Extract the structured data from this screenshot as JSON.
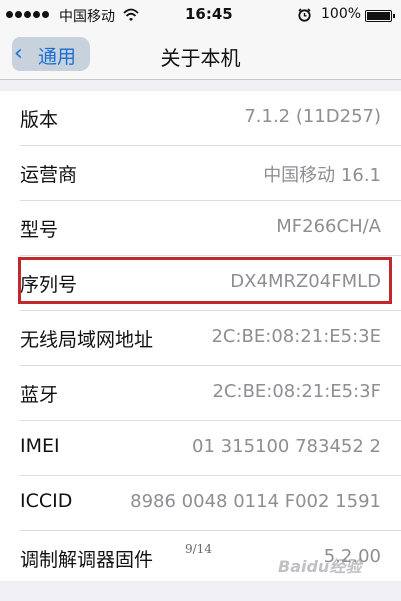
{
  "status_bar": {
    "carrier": "中国移动",
    "time": "16:45",
    "battery": "100%",
    "signal_bars": 5,
    "icons": [
      "signal-dots-icon",
      "wifi-icon",
      "alarm-clock-icon",
      "battery-icon"
    ]
  },
  "nav": {
    "back_label": "通用",
    "title": "关于本机"
  },
  "rows": [
    {
      "label": "版本",
      "value": "7.1.2 (11D257)"
    },
    {
      "label": "运营商",
      "value": "中国移动 16.1"
    },
    {
      "label": "型号",
      "value": "MF266CH/A"
    },
    {
      "label": "序列号",
      "value": "DX4MRZ04FMLD"
    },
    {
      "label": "无线局域网地址",
      "value": "2C:BE:08:21:E5:3E"
    },
    {
      "label": "蓝牙",
      "value": "2C:BE:08:21:E5:3F"
    },
    {
      "label": "IMEI",
      "value": "01 315100 783452 2"
    },
    {
      "label": "ICCID",
      "value": "8986 0048 0114 F002 1591"
    },
    {
      "label": "调制解调器固件",
      "value": "5.2.00"
    }
  ],
  "highlighted_row": "序列号",
  "colors": {
    "accent": "#1a6fd4",
    "highlight": "#c0282d",
    "value_gray": "#8e8e93",
    "background": "#efeff4"
  },
  "overlay": {
    "page_number": "9/14",
    "watermark": "Baidu经验"
  }
}
